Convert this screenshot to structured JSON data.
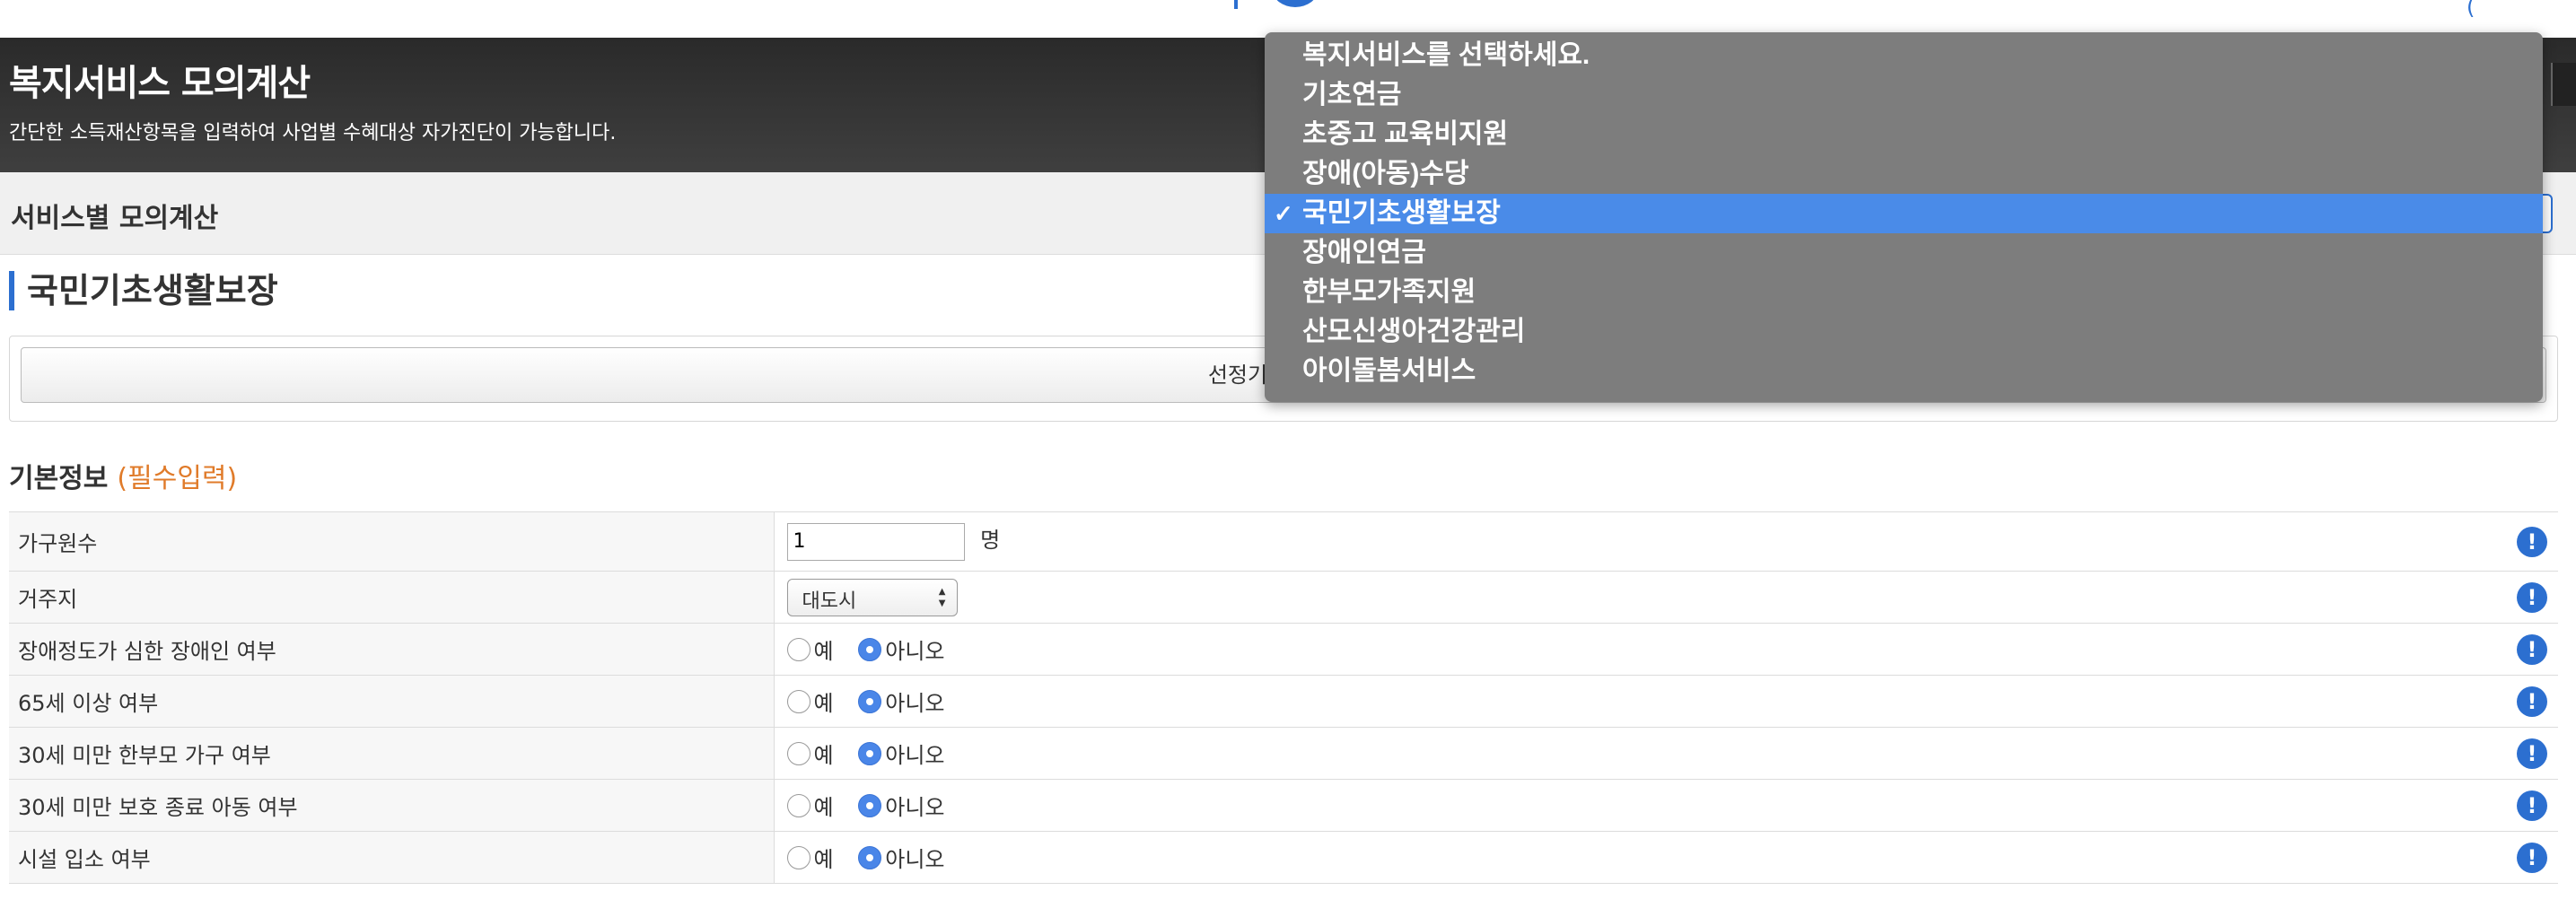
{
  "header": {
    "title": "복지서비스 모의계산",
    "subtitle": "간단한 소득재산항목을 입력하여 사업별 수혜대상 자가진단이 가능합니다."
  },
  "service_bar": {
    "label": "서비스별 모의계산",
    "options": [
      "복지서비스를 선택하세요.",
      "기초연금",
      "초중고 교육비지원",
      "장애(아동)수당",
      "국민기초생활보장",
      "장애인연금",
      "한부모가족지원",
      "산모신생아건강관리",
      "아이돌봄서비스"
    ],
    "selected": "국민기초생활보장",
    "check_mark": "✓"
  },
  "section": {
    "title": "국민기초생활보장",
    "criteria_button": "선정기준"
  },
  "basic_info": {
    "title": "기본정보",
    "required_tag": "(필수입력)"
  },
  "form": {
    "household_label": "가구원수",
    "household_value": "1",
    "household_unit": "명",
    "residence_label": "거주지",
    "residence_value": "대도시",
    "yes_label": "예",
    "no_label": "아니오",
    "radio_rows": [
      {
        "label": "장애정도가 심한 장애인 여부",
        "selected": "아니오"
      },
      {
        "label": "65세 이상 여부",
        "selected": "아니오"
      },
      {
        "label": "30세 미만 한부모 가구 여부",
        "selected": "아니오"
      },
      {
        "label": "30세 미만 보호 종료 아동 여부",
        "selected": "아니오"
      },
      {
        "label": "시설 입소 여부",
        "selected": "아니오"
      }
    ],
    "info_icon": "!"
  },
  "colors": {
    "accent": "#2c6fd0",
    "header_bg": "#333333",
    "required": "#e07b2a",
    "dropdown_bg": "#7d7d7d",
    "dropdown_selected": "#4a8be8"
  }
}
